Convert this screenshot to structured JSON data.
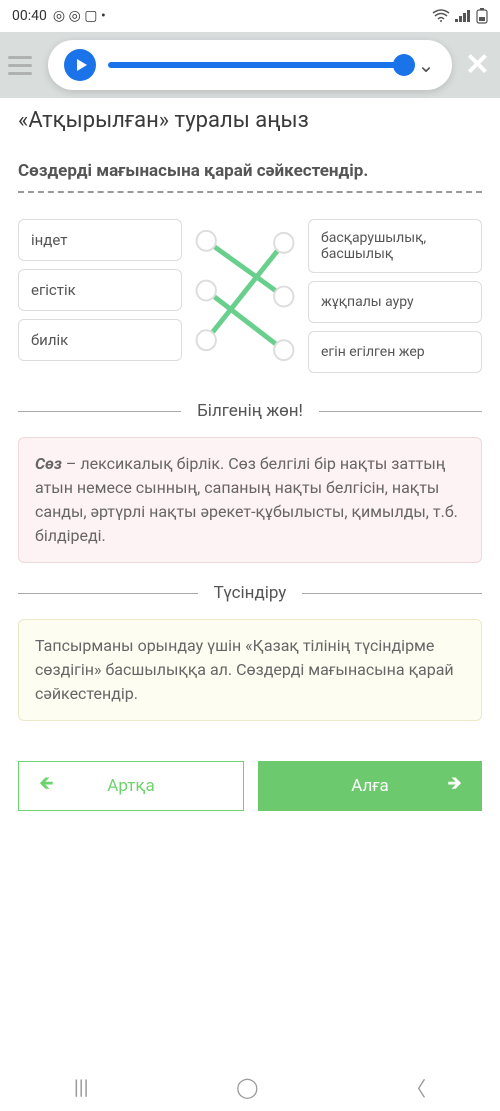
{
  "status": {
    "time": "00:40",
    "icons": "◎ ◎ ▢ •"
  },
  "page": {
    "title": "«Атқырылған» туралы аңыз",
    "instruction": "Сөздерді мағынасына қарай сәйкестендір."
  },
  "match": {
    "left": [
      "індет",
      "егістік",
      "билік"
    ],
    "right": [
      "басқарушылық, басшылық",
      "жұқпалы ауру",
      "егін егілген жер"
    ]
  },
  "feedback": "Білгенің жөн!",
  "info": {
    "bold": "Сөз",
    "text": " – лексикалық бірлік. Сөз белгілі бір нақты заттың атын немесе сынның, сапаның нақты белгісін, нақты санды, әртүрлі нақты әрекет-құбылысты, қимылды, т.б. білдіреді."
  },
  "explain_label": "Түсіндіру",
  "tip": "Тапсырманы орындау үшін «Қазақ тілінің түсіндірме сөздігін» басшылыққа ал. Сөздерді мағынасына қарай сәйкестендір.",
  "buttons": {
    "back": "Артқа",
    "next": "Алға"
  }
}
